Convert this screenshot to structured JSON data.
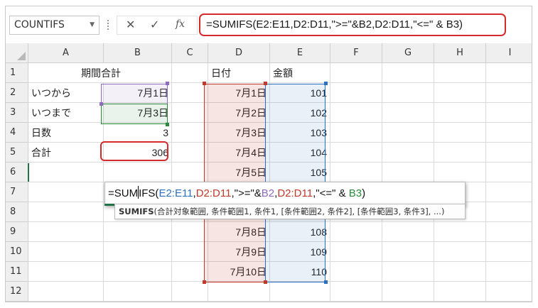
{
  "name_box": "COUNTIFS",
  "formula_buttons": {
    "cancel": "✕",
    "enter": "✓",
    "function": "fx"
  },
  "formula_bar": "=SUMIFS(E2:E11,D2:D11,\">=\"&B2,D2:D11,\"<=\" & B3)",
  "columns": [
    "A",
    "B",
    "C",
    "D",
    "E",
    "F",
    "G",
    "H",
    "I"
  ],
  "rows": [
    "1",
    "2",
    "3",
    "4",
    "5",
    "6",
    "7",
    "8",
    "9",
    "10",
    "11",
    "12"
  ],
  "cells": {
    "A1": "期間合計",
    "A2": "いつから",
    "B2": "7月1日",
    "A3": "いつまで",
    "B3": "7月3日",
    "A4": "日数",
    "B4": "3",
    "A5": "合計",
    "B5": "306",
    "D1": "日付",
    "E1": "金額",
    "D2": "7月1日",
    "E2": "101",
    "D3": "7月2日",
    "E3": "102",
    "D4": "7月3日",
    "E4": "103",
    "D5": "7月4日",
    "E5": "104",
    "D6": "7月5日",
    "E6": "105",
    "D9": "7月8日",
    "E9": "108",
    "D10": "7月9日",
    "E10": "109",
    "D11": "7月10日",
    "E11": "110"
  },
  "edit_formula": {
    "p1": "=SUM",
    "p2": "IFS(",
    "r1": "E2:E11",
    "c1": ",",
    "r2": "D2:D11",
    "p3": ",\">=\"&",
    "r3": "B2",
    "c2": ",",
    "r4": "D2:D11",
    "p4": ",\"<=\" & ",
    "r5": "B3",
    "p5": ")"
  },
  "tooltip": {
    "fn": "SUMIFS",
    "args": "(合計対象範囲, 条件範囲1, 条件1, [条件範囲2, 条件2], [条件範囲3, 条件3], ...)"
  },
  "colors": {
    "red_range": "#c0392b",
    "blue_range": "#2d6fbf",
    "green_range": "#2c8a3a",
    "purple_range": "#8e6bbf",
    "highlight_box": "#d42a2a"
  }
}
